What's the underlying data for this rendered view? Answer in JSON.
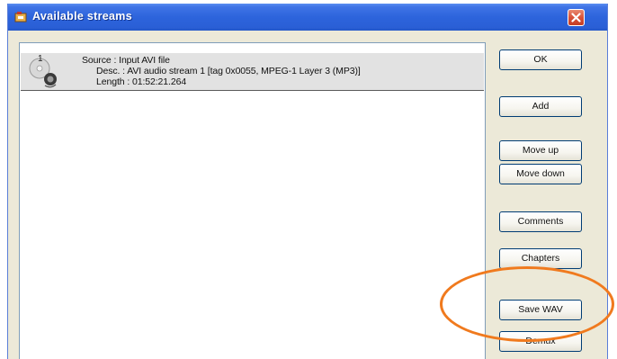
{
  "window": {
    "title": "Available streams"
  },
  "stream": {
    "index": "1",
    "source": "Source : Input AVI file",
    "desc": "Desc. : AVI audio stream 1 [tag 0x0055, MPEG-1 Layer 3 (MP3)]",
    "length": "Length : 01:52:21.264"
  },
  "buttons": {
    "ok": "OK",
    "add": "Add",
    "move_up": "Move up",
    "move_down": "Move down",
    "comments": "Comments",
    "chapters": "Chapters",
    "save_wav": "Save WAV",
    "demux": "Demux"
  },
  "colors": {
    "titlebar": "#2a5fd6",
    "highlight": "#f07a1e",
    "selected_row": "#e2e2e2"
  }
}
